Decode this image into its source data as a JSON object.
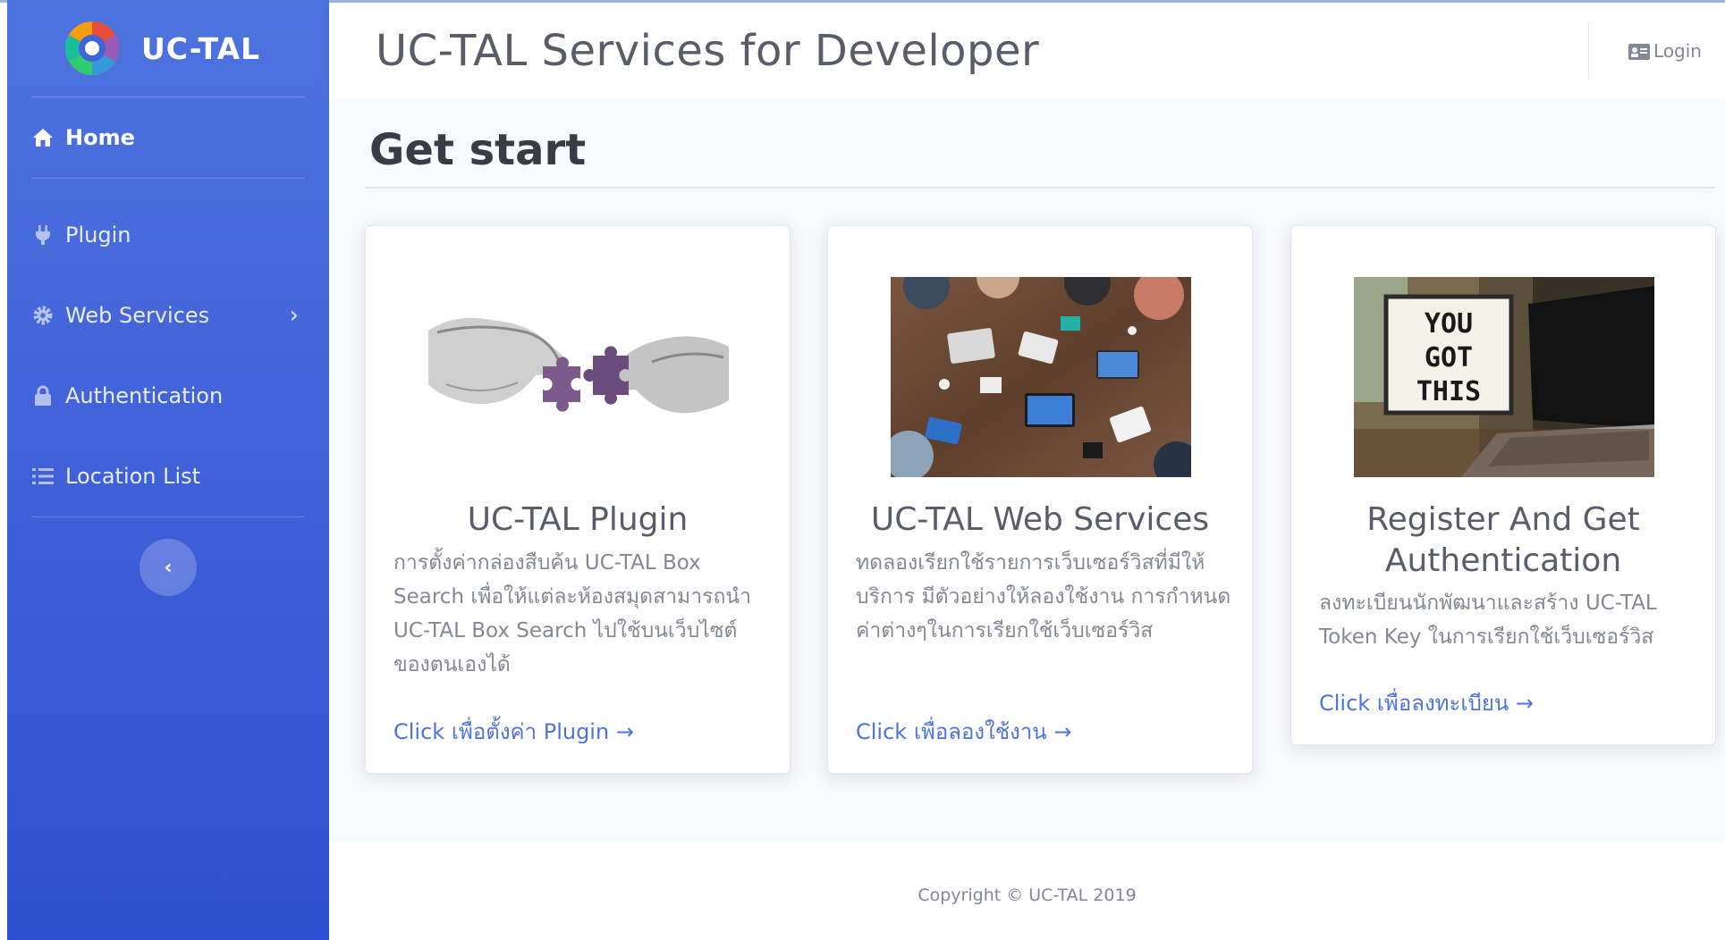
{
  "brand": {
    "name": "UC-TAL",
    "logo_icon": "uctal-logo-icon"
  },
  "sidebar": {
    "items": [
      {
        "label": "Home",
        "icon": "home-icon",
        "active": true
      },
      {
        "label": "Plugin",
        "icon": "plug-icon"
      },
      {
        "label": "Web Services",
        "icon": "gear-icon",
        "has_submenu": true
      },
      {
        "label": "Authentication",
        "icon": "lock-icon"
      },
      {
        "label": "Location List",
        "icon": "list-icon"
      }
    ],
    "toggle_icon": "chevron-left-icon"
  },
  "topbar": {
    "title": "UC-TAL Services for Developer",
    "login_label": "Login",
    "login_icon": "id-card-icon"
  },
  "page": {
    "heading": "Get start"
  },
  "cards": [
    {
      "title": "UC-TAL Plugin",
      "text": "การตั้งค่ากล่องสืบค้น UC-TAL Box Search เพื่อให้แต่ละห้องสมุดสามารถนำ UC-TAL Box Search ไปใช้บนเว็บไซต์ของตนเองได้",
      "link": "Click เพื่อตั้งค่า Plugin →",
      "image": "puzzle-hands-image"
    },
    {
      "title": "UC-TAL Web Services",
      "text": "ทดลองเรียกใช้รายการเว็บเซอร์วิสที่มีให้บริการ มีตัวอย่างให้ลองใช้งาน การกำหนดค่าต่างๆในการเรียกใช้เว็บเซอร์วิส",
      "link": "Click เพื่อลองใช้งาน →",
      "image": "team-desk-image"
    },
    {
      "title": "Register And Get Authentication",
      "text": "ลงทะเบียนนักพัฒนาและสร้าง UC-TAL Token Key ในการเรียกใช้เว็บเซอร์วิส",
      "link": "Click เพื่อลงทะเบียน →",
      "image": "you-got-this-lightbox-image",
      "image_text": [
        "YOU",
        "GOT",
        "THIS"
      ]
    }
  ],
  "footer": {
    "copyright": "Copyright © UC-TAL 2019"
  },
  "colors": {
    "primary": "#4e73df",
    "sidebar_bottom": "#2f4fd2",
    "text_muted": "#858796",
    "heading": "#5a5c69"
  }
}
